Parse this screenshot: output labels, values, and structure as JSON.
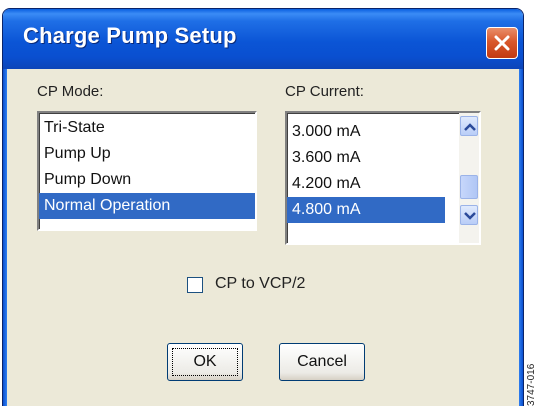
{
  "window": {
    "title": "Charge Pump Setup"
  },
  "cp_mode": {
    "label": "CP Mode:",
    "items": [
      "Tri-State",
      "Pump Up",
      "Pump Down",
      "Normal Operation"
    ],
    "selected_index": 3
  },
  "cp_current": {
    "label": "CP Current:",
    "items": [
      "3.000 mA",
      "3.600 mA",
      "4.200 mA",
      "4.800 mA"
    ],
    "selected_index": 3
  },
  "checkbox": {
    "label": "CP to VCP/2",
    "checked": false
  },
  "buttons": {
    "ok": "OK",
    "cancel": "Cancel"
  },
  "figure_code": "3747-016",
  "colors": {
    "selection": "#316ac5",
    "dialog_bg": "#ece9d8",
    "titlebar": "#0b55d6"
  }
}
